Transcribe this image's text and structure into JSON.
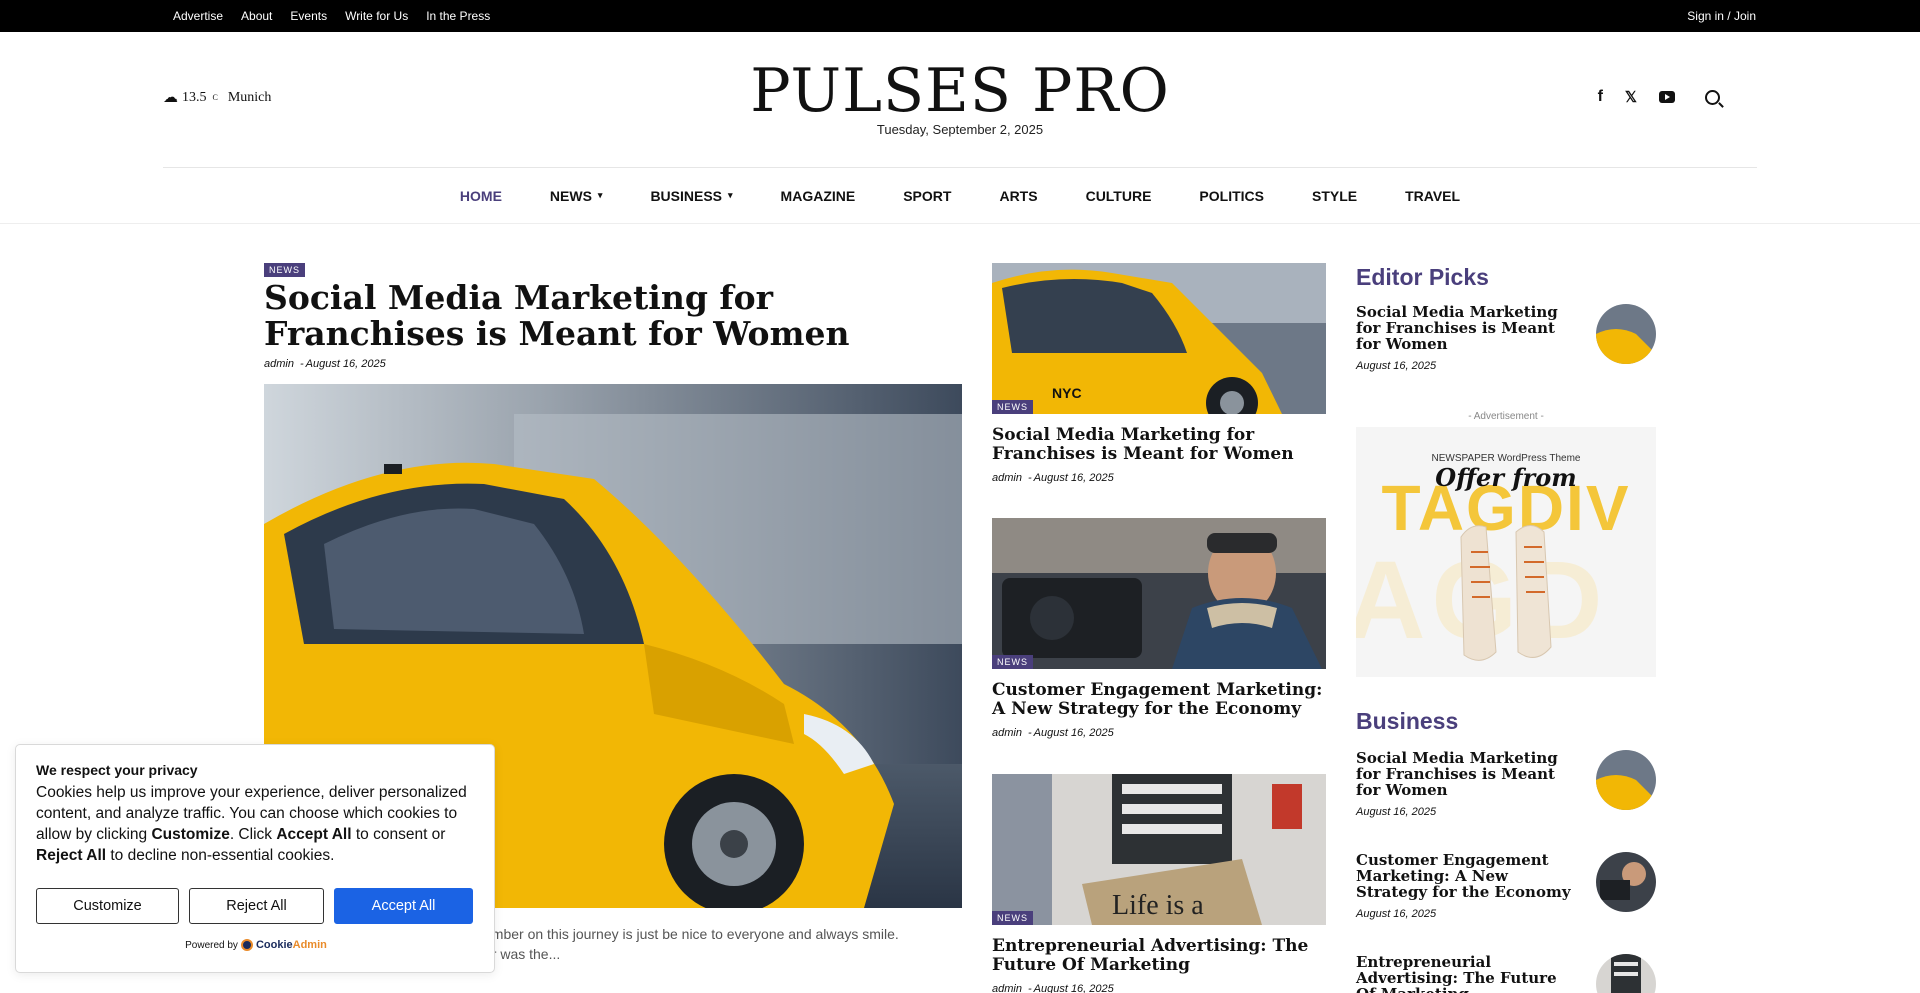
{
  "topbar": {
    "links": [
      "Advertise",
      "About",
      "Events",
      "Write for Us",
      "In the Press"
    ],
    "signin": "Sign in / Join"
  },
  "header": {
    "weather": {
      "icon": "cloud-icon",
      "temp": "13.5",
      "unit": "C",
      "city": "Munich"
    },
    "logo": "PULSES PRO",
    "date": "Tuesday, September 2, 2025",
    "socials": [
      "facebook-icon",
      "x-twitter-icon",
      "youtube-icon"
    ]
  },
  "nav": {
    "items": [
      {
        "label": "HOME",
        "active": true
      },
      {
        "label": "NEWS",
        "dropdown": true
      },
      {
        "label": "BUSINESS",
        "dropdown": true
      },
      {
        "label": "MAGAZINE"
      },
      {
        "label": "SPORT"
      },
      {
        "label": "ARTS"
      },
      {
        "label": "CULTURE"
      },
      {
        "label": "POLITICS"
      },
      {
        "label": "STYLE"
      },
      {
        "label": "TRAVEL"
      }
    ]
  },
  "main_article": {
    "category": "NEWS",
    "title": "Social Media Marketing for Franchises is Meant for Women",
    "author": "admin",
    "date": "August 16, 2025",
    "excerpt": "ember on this journey is just be nice to everyone and always smile.",
    "excerpt2": "er was the..."
  },
  "middle_articles": [
    {
      "category": "NEWS",
      "title": "Social Media Marketing for Franchises is Meant for Women",
      "author": "admin",
      "date": "August 16, 2025"
    },
    {
      "category": "NEWS",
      "title": "Customer Engagement Marketing: A New Strategy for the Economy",
      "author": "admin",
      "date": "August 16, 2025"
    },
    {
      "category": "NEWS",
      "title": "Entrepreneurial Advertising: The Future Of Marketing",
      "author": "admin",
      "date": "August 16, 2025"
    }
  ],
  "sidebar": {
    "editor_picks": {
      "heading": "Editor Picks",
      "items": [
        {
          "title": "Social Media Marketing for Franchises is Meant for Women",
          "date": "August 16, 2025"
        }
      ]
    },
    "ad": {
      "label": "- Advertisement -",
      "small": "NEWSPAPER WordPress Theme",
      "offer": "Offer from",
      "brand": "TAGDIV"
    },
    "business": {
      "heading": "Business",
      "items": [
        {
          "title": "Social Media Marketing for Franchises is Meant for Women",
          "date": "August 16, 2025"
        },
        {
          "title": "Customer Engagement Marketing: A New Strategy for the Economy",
          "date": "August 16, 2025"
        },
        {
          "title": "Entrepreneurial Advertising: The Future Of Marketing",
          "date": ""
        }
      ]
    }
  },
  "cookie": {
    "heading": "We respect your privacy",
    "text_1": "Cookies help us improve your experience, deliver personalized content, and analyze traffic. You can choose which cookies to allow by clicking ",
    "customize_word": "Customize",
    "text_2": ". Click ",
    "accept_word": "Accept All",
    "text_3": " to consent or ",
    "reject_word": "Reject All",
    "text_4": " to decline non-essential cookies.",
    "buttons": {
      "customize": "Customize",
      "reject": "Reject All",
      "accept": "Accept All"
    },
    "powered_by": "Powered by",
    "brand_a": "Cookie",
    "brand_b": "Admin"
  },
  "colors": {
    "accent": "#4a3f7c",
    "topbar": "#000000",
    "accept_button": "#1b63e4",
    "taxi_yellow": "#f2b705"
  }
}
